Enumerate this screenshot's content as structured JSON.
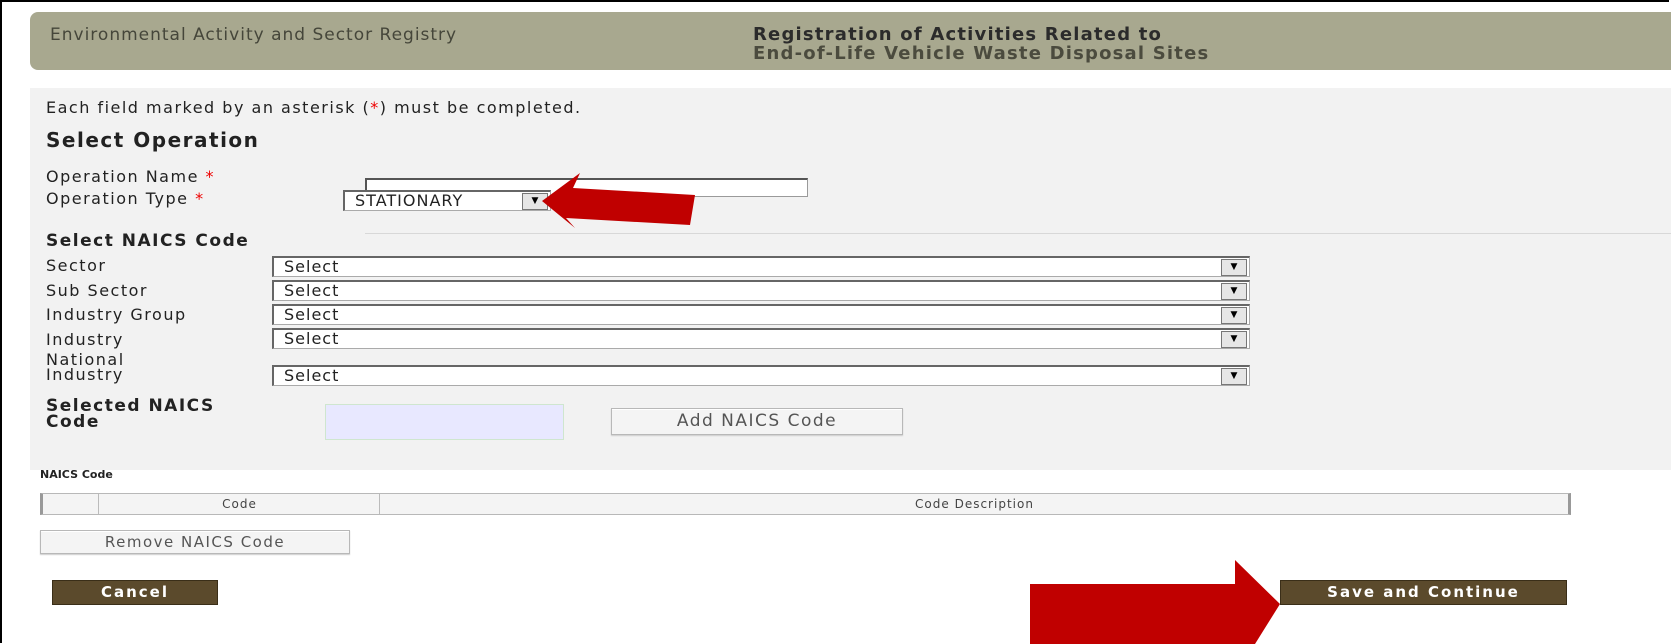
{
  "header": {
    "app_title": "Environmental Activity and Sector Registry",
    "page_title_line1": "Registration of Activities Related to",
    "page_title_line2": "End-of-Life Vehicle Waste Disposal Sites"
  },
  "form": {
    "notice_prefix": "Each field marked by an asterisk (",
    "notice_asterisk": "*",
    "notice_suffix": ") must be completed.",
    "section_title": "Select Operation",
    "operation_name_label": "Operation Name",
    "operation_name_value": "",
    "operation_type_label": "Operation Type",
    "operation_type_value": "STATIONARY",
    "required_marker": "*",
    "naics_section_title": "Select NAICS Code",
    "sector_label": "Sector",
    "sub_sector_label": "Sub Sector",
    "industry_group_label": "Industry Group",
    "industry_label": "Industry",
    "national_industry_label_l1": "National",
    "national_industry_label_l2": "Industry",
    "select_placeholder": "Select",
    "selected_naics_label_l1": "Selected NAICS",
    "selected_naics_label_l2": "Code",
    "add_naics_button": "Add NAICS Code"
  },
  "table": {
    "heading": "NAICS Code",
    "columns": [
      "",
      "Code",
      "Code Description"
    ]
  },
  "actions": {
    "remove_naics_button": "Remove NAICS Code",
    "cancel_button": "Cancel",
    "save_continue_button": "Save and Continue"
  },
  "colors": {
    "header_bg": "#a8a88f",
    "dark_button": "#5b4a2c",
    "annotation_arrow": "#c00000",
    "required": "#e00000"
  }
}
